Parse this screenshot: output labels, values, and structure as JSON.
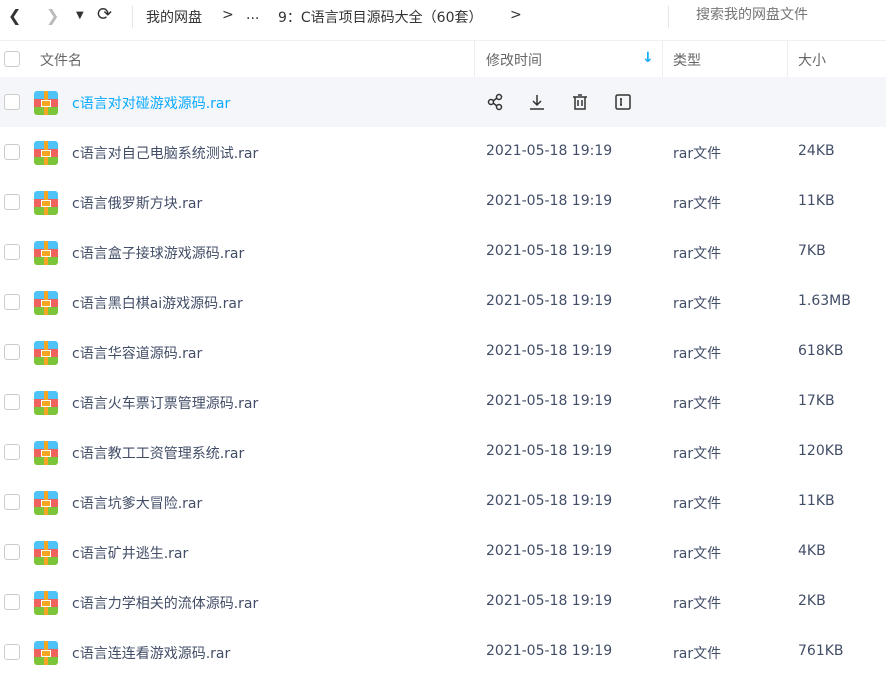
{
  "nav": {
    "back_icon": "chevron-left",
    "forward_icon": "chevron-right",
    "history_icon": "caret-down",
    "refresh_icon": "refresh"
  },
  "breadcrumb": {
    "root": "我的网盘",
    "sep": ">",
    "ellipsis": "...",
    "current": "9：C语言项目源码大全（60套）",
    "trail_sep": ">"
  },
  "search": {
    "placeholder": "搜索我的网盘文件"
  },
  "columns": {
    "name": "文件名",
    "modified": "修改时间",
    "sort_icon": "↓",
    "type": "类型",
    "size": "大小"
  },
  "accent": "#09aaff",
  "files": [
    {
      "name": "c语言对对碰游戏源码.rar",
      "modified": "",
      "type": "",
      "size": ""
    },
    {
      "name": "c语言对自己电脑系统测试.rar",
      "modified": "2021-05-18 19:19",
      "type": "rar文件",
      "size": "24KB"
    },
    {
      "name": "c语言俄罗斯方块.rar",
      "modified": "2021-05-18 19:19",
      "type": "rar文件",
      "size": "11KB"
    },
    {
      "name": "c语言盒子接球游戏源码.rar",
      "modified": "2021-05-18 19:19",
      "type": "rar文件",
      "size": "7KB"
    },
    {
      "name": "c语言黑白棋ai游戏源码.rar",
      "modified": "2021-05-18 19:19",
      "type": "rar文件",
      "size": "1.63MB"
    },
    {
      "name": "c语言华容道源码.rar",
      "modified": "2021-05-18 19:19",
      "type": "rar文件",
      "size": "618KB"
    },
    {
      "name": "c语言火车票订票管理源码.rar",
      "modified": "2021-05-18 19:19",
      "type": "rar文件",
      "size": "17KB"
    },
    {
      "name": "c语言教工工资管理系统.rar",
      "modified": "2021-05-18 19:19",
      "type": "rar文件",
      "size": "120KB"
    },
    {
      "name": "c语言坑爹大冒险.rar",
      "modified": "2021-05-18 19:19",
      "type": "rar文件",
      "size": "11KB"
    },
    {
      "name": "c语言矿井逃生.rar",
      "modified": "2021-05-18 19:19",
      "type": "rar文件",
      "size": "4KB"
    },
    {
      "name": "c语言力学相关的流体源码.rar",
      "modified": "2021-05-18 19:19",
      "type": "rar文件",
      "size": "2KB"
    },
    {
      "name": "c语言连连看游戏源码.rar",
      "modified": "2021-05-18 19:19",
      "type": "rar文件",
      "size": "761KB"
    }
  ]
}
